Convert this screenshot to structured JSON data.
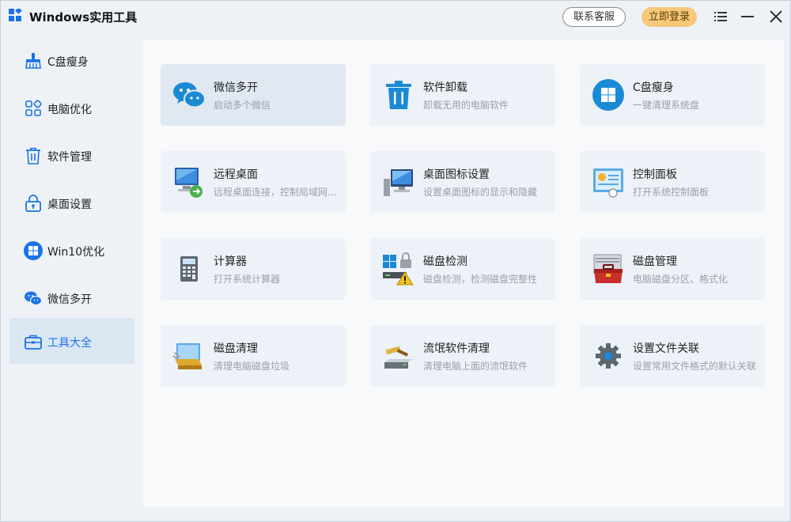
{
  "app": {
    "title": "Windows实用工具",
    "support_label": "联系客服",
    "login_label": "立即登录"
  },
  "colors": {
    "accent": "#1a73e8",
    "login_bg": "#f6c878",
    "sidebar_active_bg": "#dbe6f3",
    "card_bg": "#edf2f8"
  },
  "sidebar": {
    "items": [
      {
        "label": "C盘瘦身",
        "icon": "broom-icon"
      },
      {
        "label": "电脑优化",
        "icon": "grid-icon"
      },
      {
        "label": "软件管理",
        "icon": "trash-icon"
      },
      {
        "label": "桌面设置",
        "icon": "lock-icon"
      },
      {
        "label": "Win10优化",
        "icon": "windows-logo-icon"
      },
      {
        "label": "微信多开",
        "icon": "wechat-icon"
      },
      {
        "label": "工具大全",
        "icon": "toolbox-icon",
        "active": true
      }
    ]
  },
  "tools": [
    {
      "title": "微信多开",
      "subtitle": "启动多个微信",
      "icon": "wechat-icon"
    },
    {
      "title": "软件卸载",
      "subtitle": "卸载无用的电脑软件",
      "icon": "trash-icon"
    },
    {
      "title": "C盘瘦身",
      "subtitle": "一键清理系统盘",
      "icon": "windows-logo-icon"
    },
    {
      "title": "远程桌面",
      "subtitle": "远程桌面连接，控制局域网...",
      "icon": "remote-desktop-icon"
    },
    {
      "title": "桌面图标设置",
      "subtitle": "设置桌面图标的显示和隐藏",
      "icon": "desktop-computer-icon"
    },
    {
      "title": "控制面板",
      "subtitle": "打开系统控制面板",
      "icon": "control-panel-icon"
    },
    {
      "title": "计算器",
      "subtitle": "打开系统计算器",
      "icon": "calculator-icon"
    },
    {
      "title": "磁盘检测",
      "subtitle": "磁盘检测，检测磁盘完整性",
      "icon": "disk-check-icon"
    },
    {
      "title": "磁盘管理",
      "subtitle": "电脑磁盘分区、格式化",
      "icon": "disk-management-icon"
    },
    {
      "title": "磁盘清理",
      "subtitle": "清理电脑磁盘垃圾",
      "icon": "disk-cleanup-icon"
    },
    {
      "title": "流氓软件清理",
      "subtitle": "清理电脑上面的流氓软件",
      "icon": "malware-cleanup-icon"
    },
    {
      "title": "设置文件关联",
      "subtitle": "设置常用文件格式的默认关联",
      "icon": "gear-icon"
    }
  ]
}
